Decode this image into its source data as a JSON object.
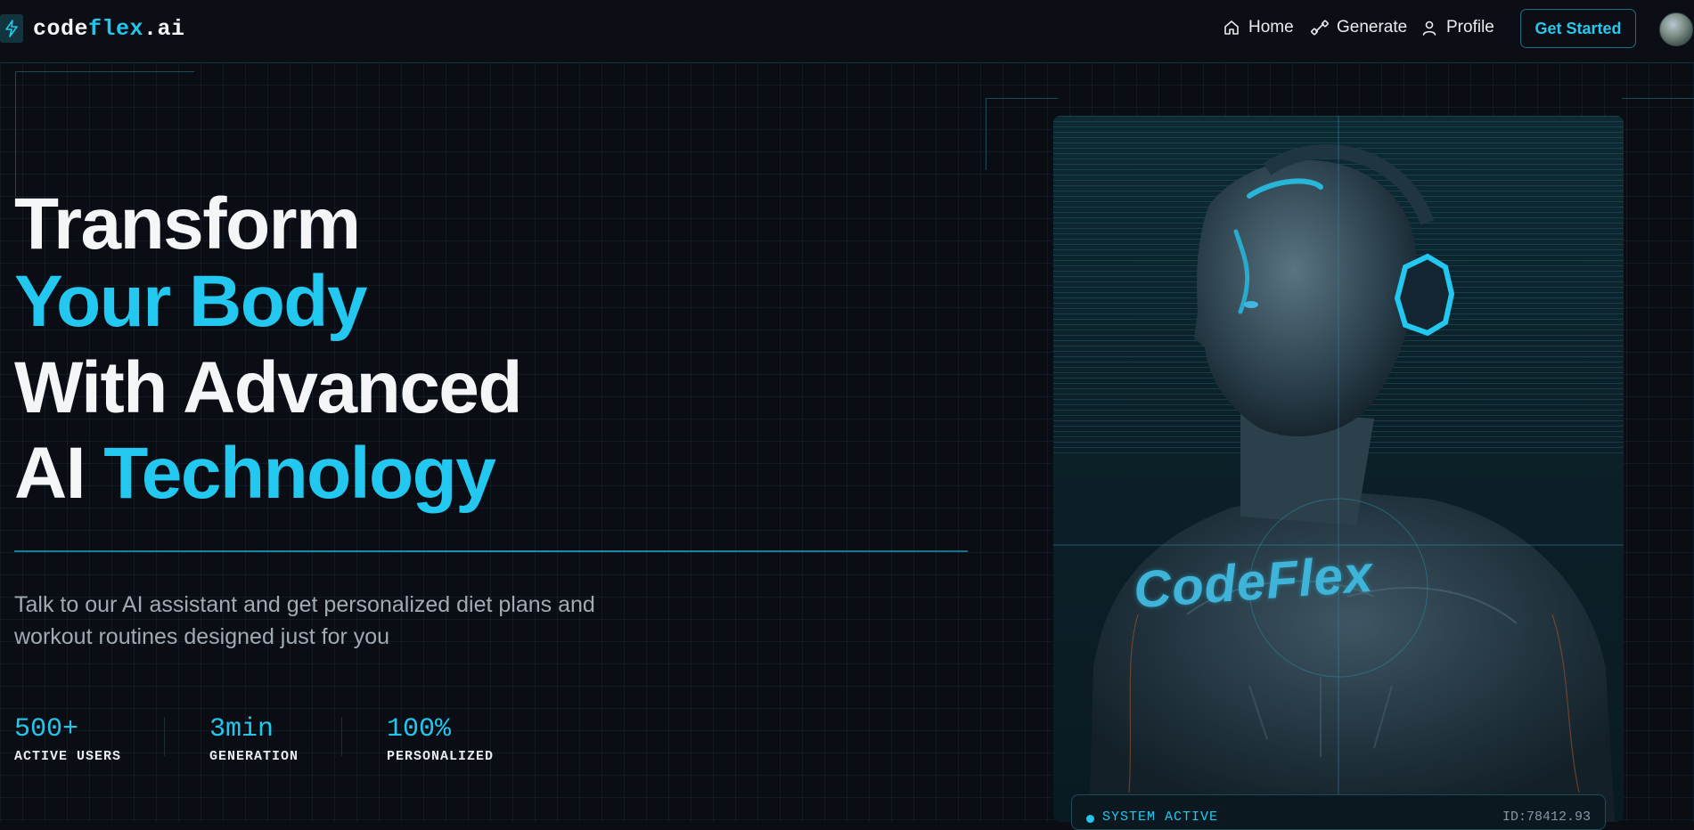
{
  "nav": {
    "logo": {
      "part1": "code",
      "part2": "flex",
      "part3": ".ai"
    },
    "links": [
      {
        "label": "Home",
        "icon": "home-icon"
      },
      {
        "label": "Generate",
        "icon": "dumbbell-icon"
      },
      {
        "label": "Profile",
        "icon": "user-icon"
      }
    ],
    "cta_label": "Get Started"
  },
  "hero": {
    "line1": "Transform",
    "line2": "Your Body",
    "line3": "With Advanced",
    "line4_a": "AI",
    "line4_b": "Technology",
    "subtitle": "Talk to our AI assistant and get personalized diet plans and workout routines designed just for you"
  },
  "stats": [
    {
      "value": "500+",
      "label": "ACTIVE USERS"
    },
    {
      "value": "3min",
      "label": "GENERATION"
    },
    {
      "value": "100%",
      "label": "PERSONALIZED"
    }
  ],
  "card": {
    "brand_text": "CodeFlex",
    "status_text": "SYSTEM ACTIVE",
    "id_text": "ID:78412.93"
  },
  "colors": {
    "accent": "#22c8ef",
    "background": "#0a0d14",
    "text": "#f4f5f7",
    "muted": "#a2aab4"
  }
}
